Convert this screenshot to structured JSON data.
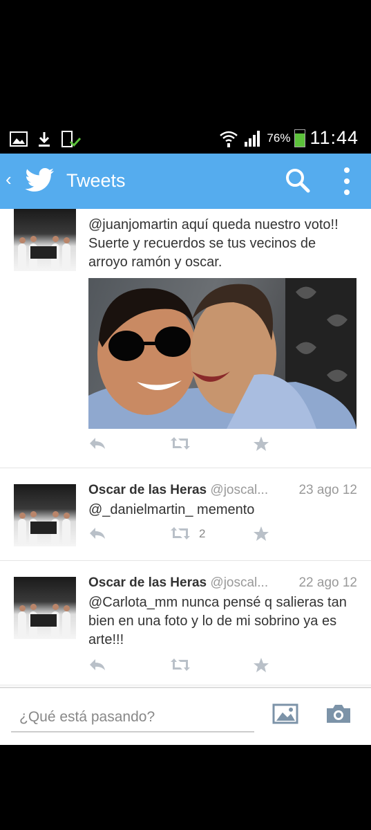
{
  "status_bar": {
    "battery": "76%",
    "time": "11:44",
    "battery_level": 0.76
  },
  "app_bar": {
    "title": "Tweets",
    "back_icon": "chevron-left-icon",
    "logo_icon": "twitter-bird-icon",
    "search_icon": "search-icon",
    "menu_icon": "overflow-menu-icon"
  },
  "tweets": [
    {
      "text": "@juanjomartin aquí queda nuestro voto!! Suerte y recuerdos se tus vecinos de arroyo ramón y oscar."
    },
    {
      "name": "Oscar de las Heras",
      "handle": "@joscal...",
      "date": "23 ago 12",
      "text": "@_danielmartin_ memento",
      "retweets": "2"
    },
    {
      "name": "Oscar de las Heras",
      "handle": "@joscal...",
      "date": "22 ago 12",
      "text": "@Carlota_mm nunca pensé q salieras tan bien en una foto y lo de mi sobrino ya es arte!!!"
    }
  ],
  "compose": {
    "placeholder": "¿Qué está pasando?"
  },
  "colors": {
    "brand": "#55acee",
    "battery": "#5cc13b"
  }
}
